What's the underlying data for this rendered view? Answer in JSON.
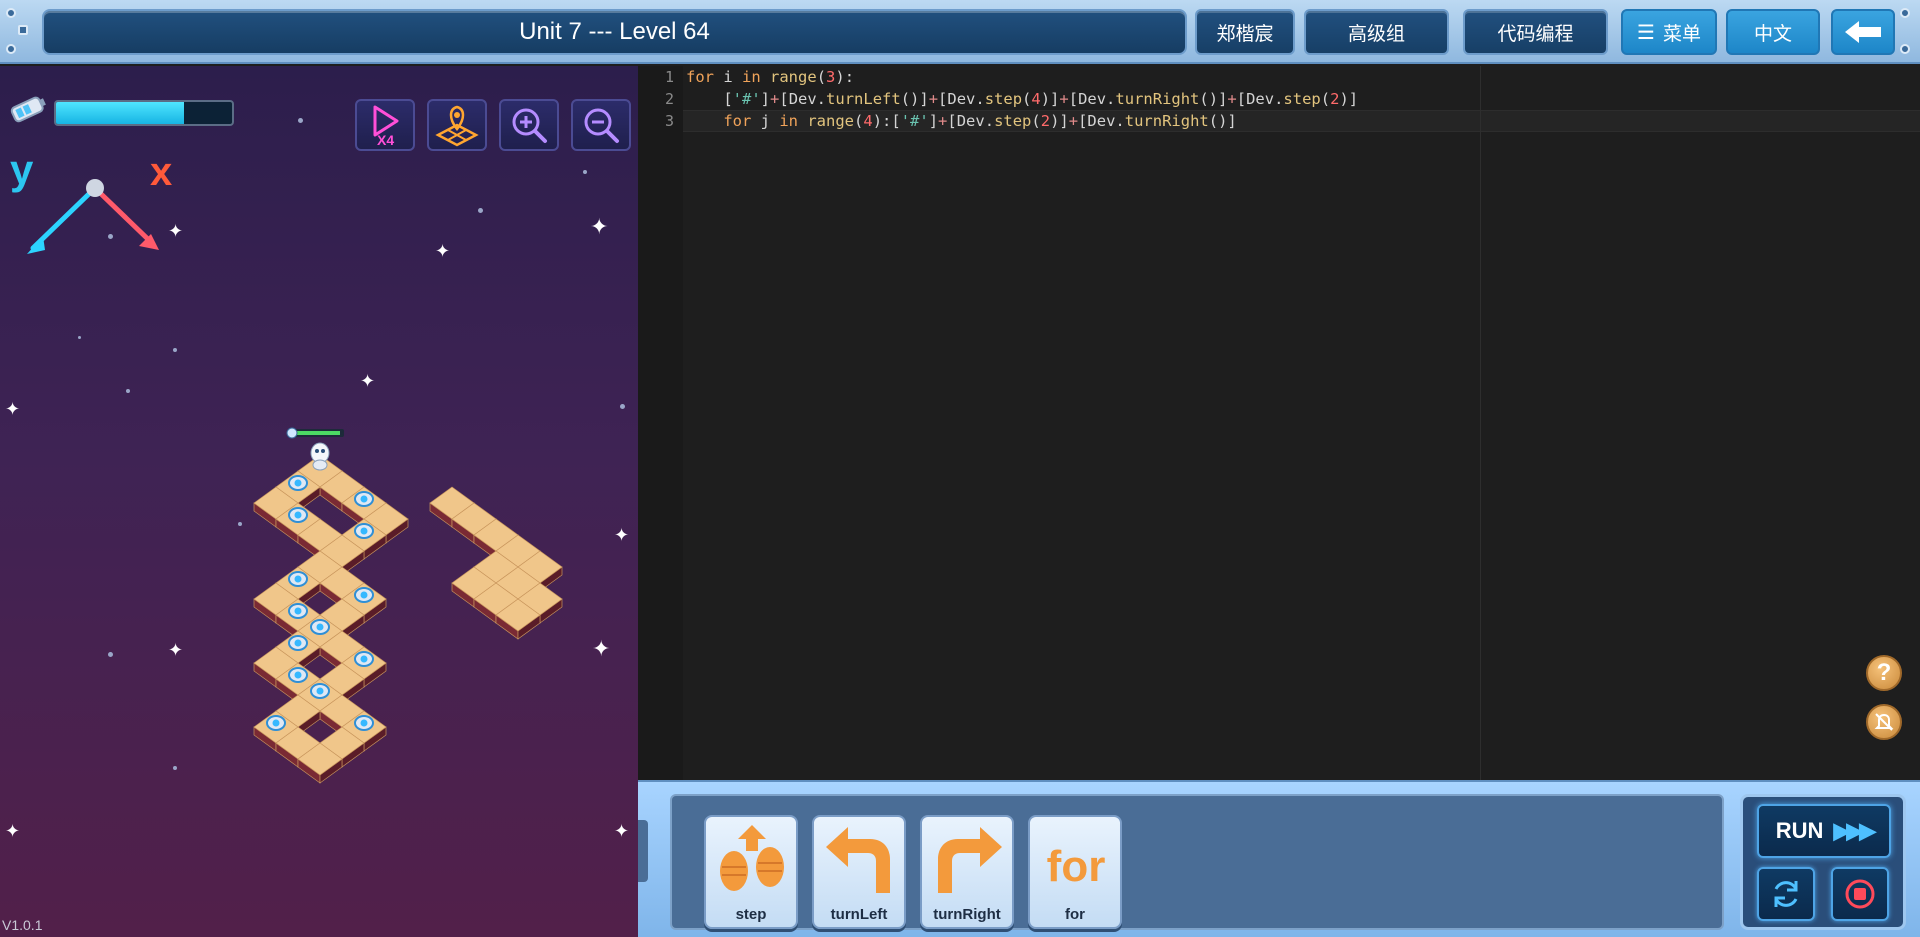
{
  "header": {
    "title": "Unit 7 --- Level 64",
    "user_name": "郑楷宸",
    "group": "高级组",
    "mode": "代码编程",
    "menu_label": "菜单",
    "language": "中文"
  },
  "game": {
    "energy_level": 0.73,
    "axis_y_label": "y",
    "axis_x_label": "x",
    "tools": [
      "speed-x4-icon",
      "map-pin-icon",
      "zoom-in-icon",
      "zoom-out-icon"
    ],
    "version": "V1.0.1"
  },
  "editor": {
    "line_numbers": [
      "1",
      "2",
      "3"
    ],
    "active_line": 3
  },
  "blocks": [
    {
      "label": "step",
      "icon": "footsteps-icon"
    },
    {
      "label": "turnLeft",
      "icon": "turn-left-arrow-icon"
    },
    {
      "label": "turnRight",
      "icon": "turn-right-arrow-icon"
    },
    {
      "label": "for",
      "icon": "for-loop-icon"
    }
  ],
  "controls": {
    "run_label": "RUN",
    "reset_icon": "refresh-icon",
    "stop_icon": "stop-icon"
  },
  "colors": {
    "accent": "#1d86c8",
    "energy": "#33d0f5",
    "code_keyword": "#f0a35a",
    "code_number": "#ff6b6b",
    "code_string": "#6ac3b0",
    "tile": "#f0c68a"
  }
}
